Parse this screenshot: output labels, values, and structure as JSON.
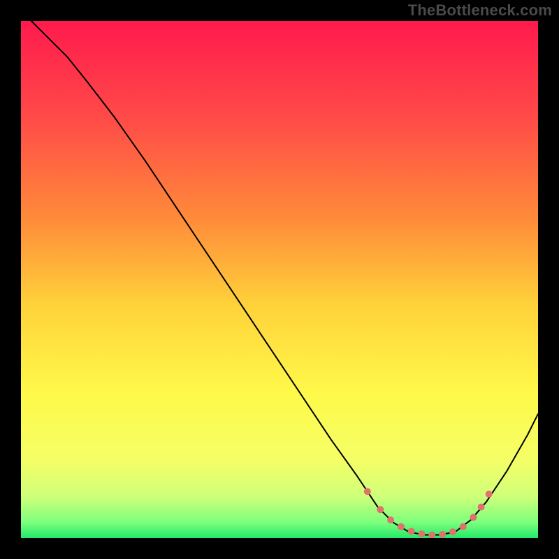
{
  "watermark": "TheBottleneck.com",
  "chart_data": {
    "type": "line",
    "title": "",
    "xlabel": "",
    "ylabel": "",
    "xlim": [
      0,
      100
    ],
    "ylim": [
      0,
      100
    ],
    "grid": false,
    "legend": false,
    "background_gradient": {
      "stops": [
        {
          "offset": 0.0,
          "color": "#ff1a4d"
        },
        {
          "offset": 0.18,
          "color": "#ff4848"
        },
        {
          "offset": 0.38,
          "color": "#ff8a3a"
        },
        {
          "offset": 0.55,
          "color": "#ffd23a"
        },
        {
          "offset": 0.72,
          "color": "#fff94a"
        },
        {
          "offset": 0.85,
          "color": "#f4ff66"
        },
        {
          "offset": 0.92,
          "color": "#cfff7a"
        },
        {
          "offset": 0.97,
          "color": "#7cff7c"
        },
        {
          "offset": 1.0,
          "color": "#22e86b"
        }
      ]
    },
    "series": [
      {
        "name": "bottleneck-curve",
        "stroke": "#000000",
        "stroke_width": 2,
        "points": [
          {
            "x": 2.0,
            "y": 100.0
          },
          {
            "x": 5.0,
            "y": 97.0
          },
          {
            "x": 9.0,
            "y": 93.0
          },
          {
            "x": 13.0,
            "y": 88.0
          },
          {
            "x": 18.0,
            "y": 81.5
          },
          {
            "x": 24.0,
            "y": 73.0
          },
          {
            "x": 30.0,
            "y": 64.0
          },
          {
            "x": 36.0,
            "y": 55.0
          },
          {
            "x": 42.0,
            "y": 46.0
          },
          {
            "x": 48.0,
            "y": 37.0
          },
          {
            "x": 54.0,
            "y": 28.0
          },
          {
            "x": 60.0,
            "y": 19.0
          },
          {
            "x": 65.0,
            "y": 12.0
          },
          {
            "x": 69.0,
            "y": 6.0
          },
          {
            "x": 72.0,
            "y": 3.0
          },
          {
            "x": 75.0,
            "y": 1.2
          },
          {
            "x": 78.0,
            "y": 0.6
          },
          {
            "x": 81.0,
            "y": 0.6
          },
          {
            "x": 84.0,
            "y": 1.2
          },
          {
            "x": 87.0,
            "y": 3.5
          },
          {
            "x": 90.0,
            "y": 7.0
          },
          {
            "x": 94.0,
            "y": 13.0
          },
          {
            "x": 98.0,
            "y": 20.0
          },
          {
            "x": 100.0,
            "y": 24.0
          }
        ]
      }
    ],
    "markers": {
      "name": "optimal-zone",
      "color": "#e0726e",
      "radius": 5,
      "points": [
        {
          "x": 67.0,
          "y": 9.0
        },
        {
          "x": 69.5,
          "y": 5.5
        },
        {
          "x": 71.5,
          "y": 3.5
        },
        {
          "x": 73.5,
          "y": 2.2
        },
        {
          "x": 75.5,
          "y": 1.3
        },
        {
          "x": 77.5,
          "y": 0.8
        },
        {
          "x": 79.5,
          "y": 0.6
        },
        {
          "x": 81.5,
          "y": 0.7
        },
        {
          "x": 83.5,
          "y": 1.2
        },
        {
          "x": 85.5,
          "y": 2.2
        },
        {
          "x": 87.5,
          "y": 4.0
        },
        {
          "x": 89.0,
          "y": 6.0
        },
        {
          "x": 90.5,
          "y": 8.5
        }
      ]
    }
  }
}
